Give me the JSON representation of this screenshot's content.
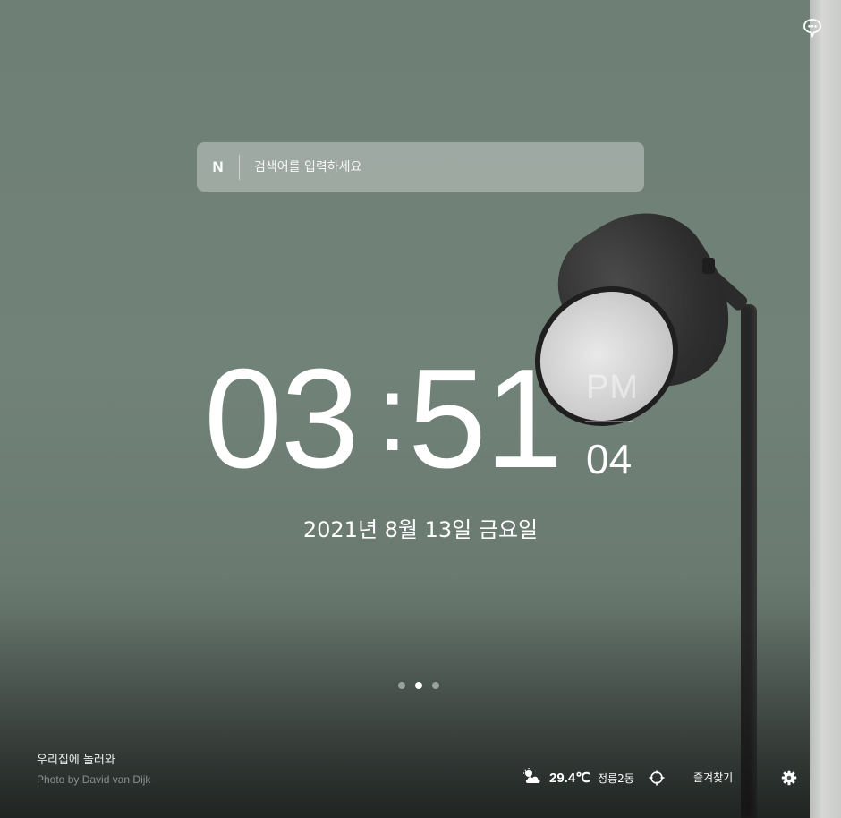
{
  "search": {
    "logo": "N",
    "placeholder": "검색어를 입력하세요"
  },
  "clock": {
    "hours": "03",
    "separator": ":",
    "minutes": "51",
    "ampm": "PM",
    "seconds": "04"
  },
  "date": "2021년 8월 13일 금요일",
  "pager": {
    "count": 3,
    "active_index": 1
  },
  "credit": {
    "title": "우리집에 놀러와",
    "photo": "Photo by David van Dijk"
  },
  "weather": {
    "icon": "cloud-sun-icon",
    "temperature": "29.4℃",
    "location": "정릉2동"
  },
  "bookmarks_label": "즐겨찾기",
  "icons": {
    "chat": "chat-bubble-icon",
    "locate": "crosshair-icon",
    "settings": "gear-icon"
  },
  "colors": {
    "background": "#718279",
    "text": "#ffffff"
  }
}
